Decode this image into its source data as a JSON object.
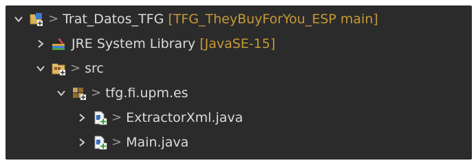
{
  "tree": {
    "project": {
      "name": "Trat_Datos_TFG",
      "meta": "[TFG_TheyBuyForYou_ESP main]",
      "icon": "java-project-git-icon"
    },
    "library": {
      "name": "JRE System Library",
      "meta": "[JavaSE-15]",
      "icon": "library-books-icon"
    },
    "src": {
      "name": "src",
      "icon": "source-folder-icon"
    },
    "package": {
      "name": "tfg.fi.upm.es",
      "icon": "package-icon"
    },
    "files": [
      {
        "name": "ExtractorXml.java",
        "icon": "java-file-icon"
      },
      {
        "name": "Main.java",
        "icon": "java-file-icon"
      }
    ],
    "separator": ">"
  },
  "colors": {
    "background": "#2b2b2b",
    "text": "#dcdcdc",
    "git_meta": "#c79a37",
    "chevron": "#cfcfcf"
  }
}
